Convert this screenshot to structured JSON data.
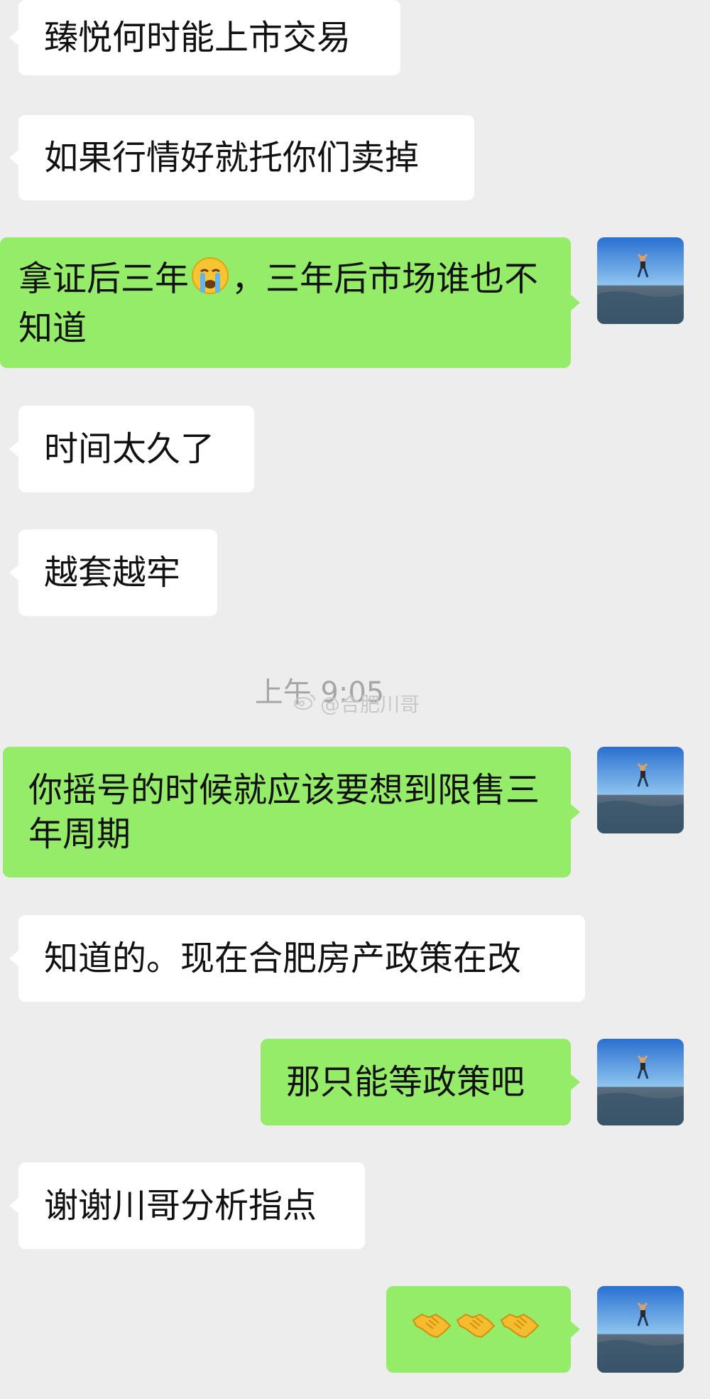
{
  "chat": {
    "messages": [
      {
        "side": "in",
        "text": "臻悦何时能上市交易"
      },
      {
        "side": "in",
        "text": "如果行情好就托你们卖掉"
      },
      {
        "side": "out",
        "text_before": "拿证后三年",
        "emoji": "crying-face",
        "text_after": "，三年后市场谁也不知道"
      },
      {
        "side": "in",
        "text": "时间太久了"
      },
      {
        "side": "in",
        "text": "越套越牢"
      },
      {
        "side": "out",
        "text": "你摇号的时候就应该要想到限售三年周期"
      },
      {
        "side": "in",
        "text": "知道的。现在合肥房产政策在改"
      },
      {
        "side": "out",
        "text": "那只能等政策吧"
      },
      {
        "side": "in",
        "text": "谢谢川哥分析指点"
      },
      {
        "side": "out",
        "emoji": "handshake",
        "count": 3
      }
    ],
    "timestamp": "上午 9:05",
    "watermark": "@合肥川哥"
  },
  "colors": {
    "background": "#ededed",
    "incoming_bubble": "#ffffff",
    "outgoing_bubble": "#95ec69"
  }
}
